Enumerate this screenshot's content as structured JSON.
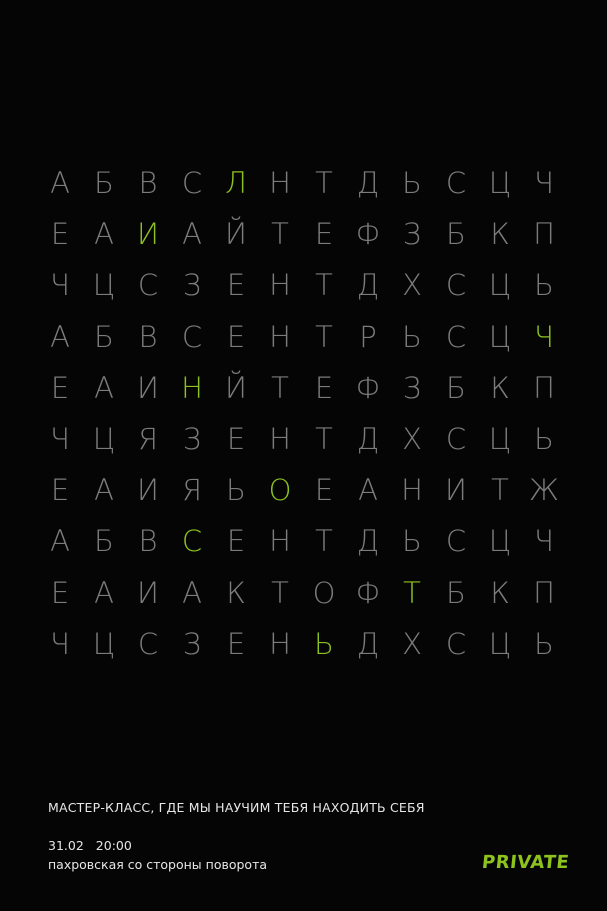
{
  "grid": {
    "highlight_color": "#8dc21f",
    "text_color": "#7c7c7c",
    "rows": [
      [
        "А",
        "Б",
        "В",
        "С",
        "Л",
        "Н",
        "Т",
        "Д",
        "Ь",
        "С",
        "Ц",
        "Ч"
      ],
      [
        "Е",
        "А",
        "И",
        "А",
        "Й",
        "Т",
        "Е",
        "Ф",
        "З",
        "Б",
        "К",
        "П"
      ],
      [
        "Ч",
        "Ц",
        "С",
        "З",
        "Е",
        "Н",
        "Т",
        "Д",
        "Х",
        "С",
        "Ц",
        "Ь"
      ],
      [
        "А",
        "Б",
        "В",
        "С",
        "Е",
        "Н",
        "Т",
        "Р",
        "Ь",
        "С",
        "Ц",
        "Ч"
      ],
      [
        "Е",
        "А",
        "И",
        "Н",
        "Й",
        "Т",
        "Е",
        "Ф",
        "З",
        "Б",
        "К",
        "П"
      ],
      [
        "Ч",
        "Ц",
        "Я",
        "З",
        "Е",
        "Н",
        "Т",
        "Д",
        "Х",
        "С",
        "Ц",
        "Ь"
      ],
      [
        "Е",
        "А",
        "И",
        "Я",
        "Ь",
        "О",
        "Е",
        "А",
        "Н",
        "И",
        "Т",
        "Ж"
      ],
      [
        "А",
        "Б",
        "В",
        "С",
        "Е",
        "Н",
        "Т",
        "Д",
        "Ь",
        "С",
        "Ц",
        "Ч"
      ],
      [
        "Е",
        "А",
        "И",
        "А",
        "К",
        "Т",
        "О",
        "Ф",
        "Т",
        "Б",
        "К",
        "П"
      ],
      [
        "Ч",
        "Ц",
        "С",
        "З",
        "Е",
        "Н",
        "Ь",
        "Д",
        "Х",
        "С",
        "Ц",
        "Ь"
      ]
    ],
    "highlights": [
      [
        0,
        4
      ],
      [
        1,
        2
      ],
      [
        3,
        11
      ],
      [
        4,
        3
      ],
      [
        6,
        5
      ],
      [
        7,
        3
      ],
      [
        8,
        8
      ],
      [
        9,
        6
      ]
    ]
  },
  "footer": {
    "title": "МАСТЕР-КЛАСС, ГДЕ МЫ НАУЧИМ ТЕБЯ НАХОДИТЬ СЕБЯ",
    "date": "31.02",
    "time": "20:00",
    "address": "пахровская со стороны поворота",
    "logo": "PRIVATE"
  }
}
